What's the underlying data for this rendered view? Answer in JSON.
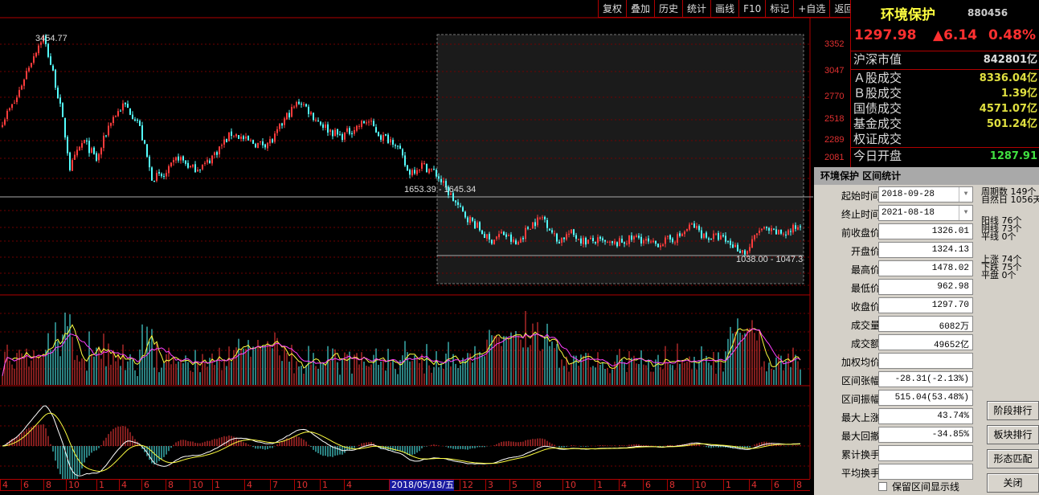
{
  "toolbar": [
    "复权",
    "叠加",
    "历史",
    "统计",
    "画线",
    "F10",
    "标记",
    "+自选",
    "返回"
  ],
  "right_panel": {
    "name": "环境保护",
    "code": "880456",
    "price": "1297.98",
    "change": "▲6.14",
    "change_pct": "0.48%",
    "rows": [
      {
        "label": "沪深市值",
        "value": "842801亿",
        "color": "#dddddd"
      },
      {
        "label": "Ａ股成交",
        "value": "8336.04亿",
        "color": "#e0e040"
      },
      {
        "label": "Ｂ股成交",
        "value": "1.39亿",
        "color": "#e0e040"
      },
      {
        "label": "国债成交",
        "value": "4571.07亿",
        "color": "#e0e040"
      },
      {
        "label": "基金成交",
        "value": "501.24亿",
        "color": "#e0e040"
      },
      {
        "label": "权证成交",
        "value": "",
        "color": "#e0e040"
      },
      {
        "label": "今日开盘",
        "value": "1287.91",
        "color": "#40e040"
      }
    ]
  },
  "dialog": {
    "title": "环境保护 区间统计",
    "fields": [
      {
        "label": "起始时间",
        "value": "2018-09-28",
        "dropdown": true
      },
      {
        "label": "终止时间",
        "value": "2021-08-18",
        "dropdown": true
      },
      {
        "label": "前收盘价",
        "value": "1326.01"
      },
      {
        "label": "开盘价",
        "value": "1324.13"
      },
      {
        "label": "最高价",
        "value": "1478.02"
      },
      {
        "label": "最低价",
        "value": "962.98"
      },
      {
        "label": "收盘价",
        "value": "1297.70"
      },
      {
        "label": "成交量",
        "value": "6082万"
      },
      {
        "label": "成交额",
        "value": "49652亿"
      },
      {
        "label": "加权均价",
        "value": ""
      },
      {
        "label": "区间张幅",
        "value": "-28.31(-2.13%)"
      },
      {
        "label": "区间振幅",
        "value": "515.04(53.48%)"
      },
      {
        "label": "最大上涨",
        "value": "43.74%"
      },
      {
        "label": "最大回撤",
        "value": "-34.85%"
      },
      {
        "label": "累计换手",
        "value": ""
      },
      {
        "label": "平均换手",
        "value": ""
      }
    ],
    "stats": [
      [
        "周期数 149个",
        "自然日 1056天"
      ],
      [
        "阳线 76个",
        "阴线 73个",
        "平线 0个"
      ],
      [
        "上涨 74个",
        "下跌 75个",
        "平盘 0个"
      ]
    ],
    "buttons": [
      "阶段排行",
      "板块排行",
      "形态匹配",
      "关闭"
    ],
    "checkbox": "保留区间显示线"
  },
  "chart": {
    "price_axis": [
      "3352",
      "3047",
      "2770",
      "2518",
      "2289",
      "2081"
    ],
    "peak_label": "3454.77",
    "range_high_label": "1653.39 - 1645.34",
    "range_low_label": "1038.00 - 1047.3",
    "x_labels": [
      "4",
      "6",
      "8",
      "10",
      "1",
      "4",
      "6",
      "8",
      "10",
      "1",
      "4",
      "7",
      "10",
      "1",
      "4",
      "2018/05/18/五",
      "12",
      "3",
      "5",
      "8",
      "10",
      "1",
      "4",
      "6",
      "8",
      "10",
      "1",
      "4",
      "6",
      "8"
    ],
    "highlight_x_label": "2018/05/18/五",
    "up_color": "#ff3c3c",
    "down_color": "#54ffff",
    "price_path": [
      2175,
      2428,
      2960,
      3454,
      2594,
      1670,
      1948,
      1744,
      2175,
      2375,
      2175,
      1598,
      1598,
      1784,
      1670,
      1707,
      1864,
      2036,
      1948,
      1906,
      1948,
      2223,
      2428,
      2223,
      2081,
      1991,
      2081,
      2175,
      1991,
      1948,
      1633,
      1707,
      1633,
      1463,
      1311,
      1227,
      1123,
      1174,
      1098,
      1227,
      1282,
      1123,
      1174,
      1123,
      1123,
      1098,
      1123,
      1148,
      1098,
      1123,
      1148,
      1227,
      1148,
      1148,
      1098,
      1051,
      1200,
      1174,
      1174,
      1227
    ]
  }
}
